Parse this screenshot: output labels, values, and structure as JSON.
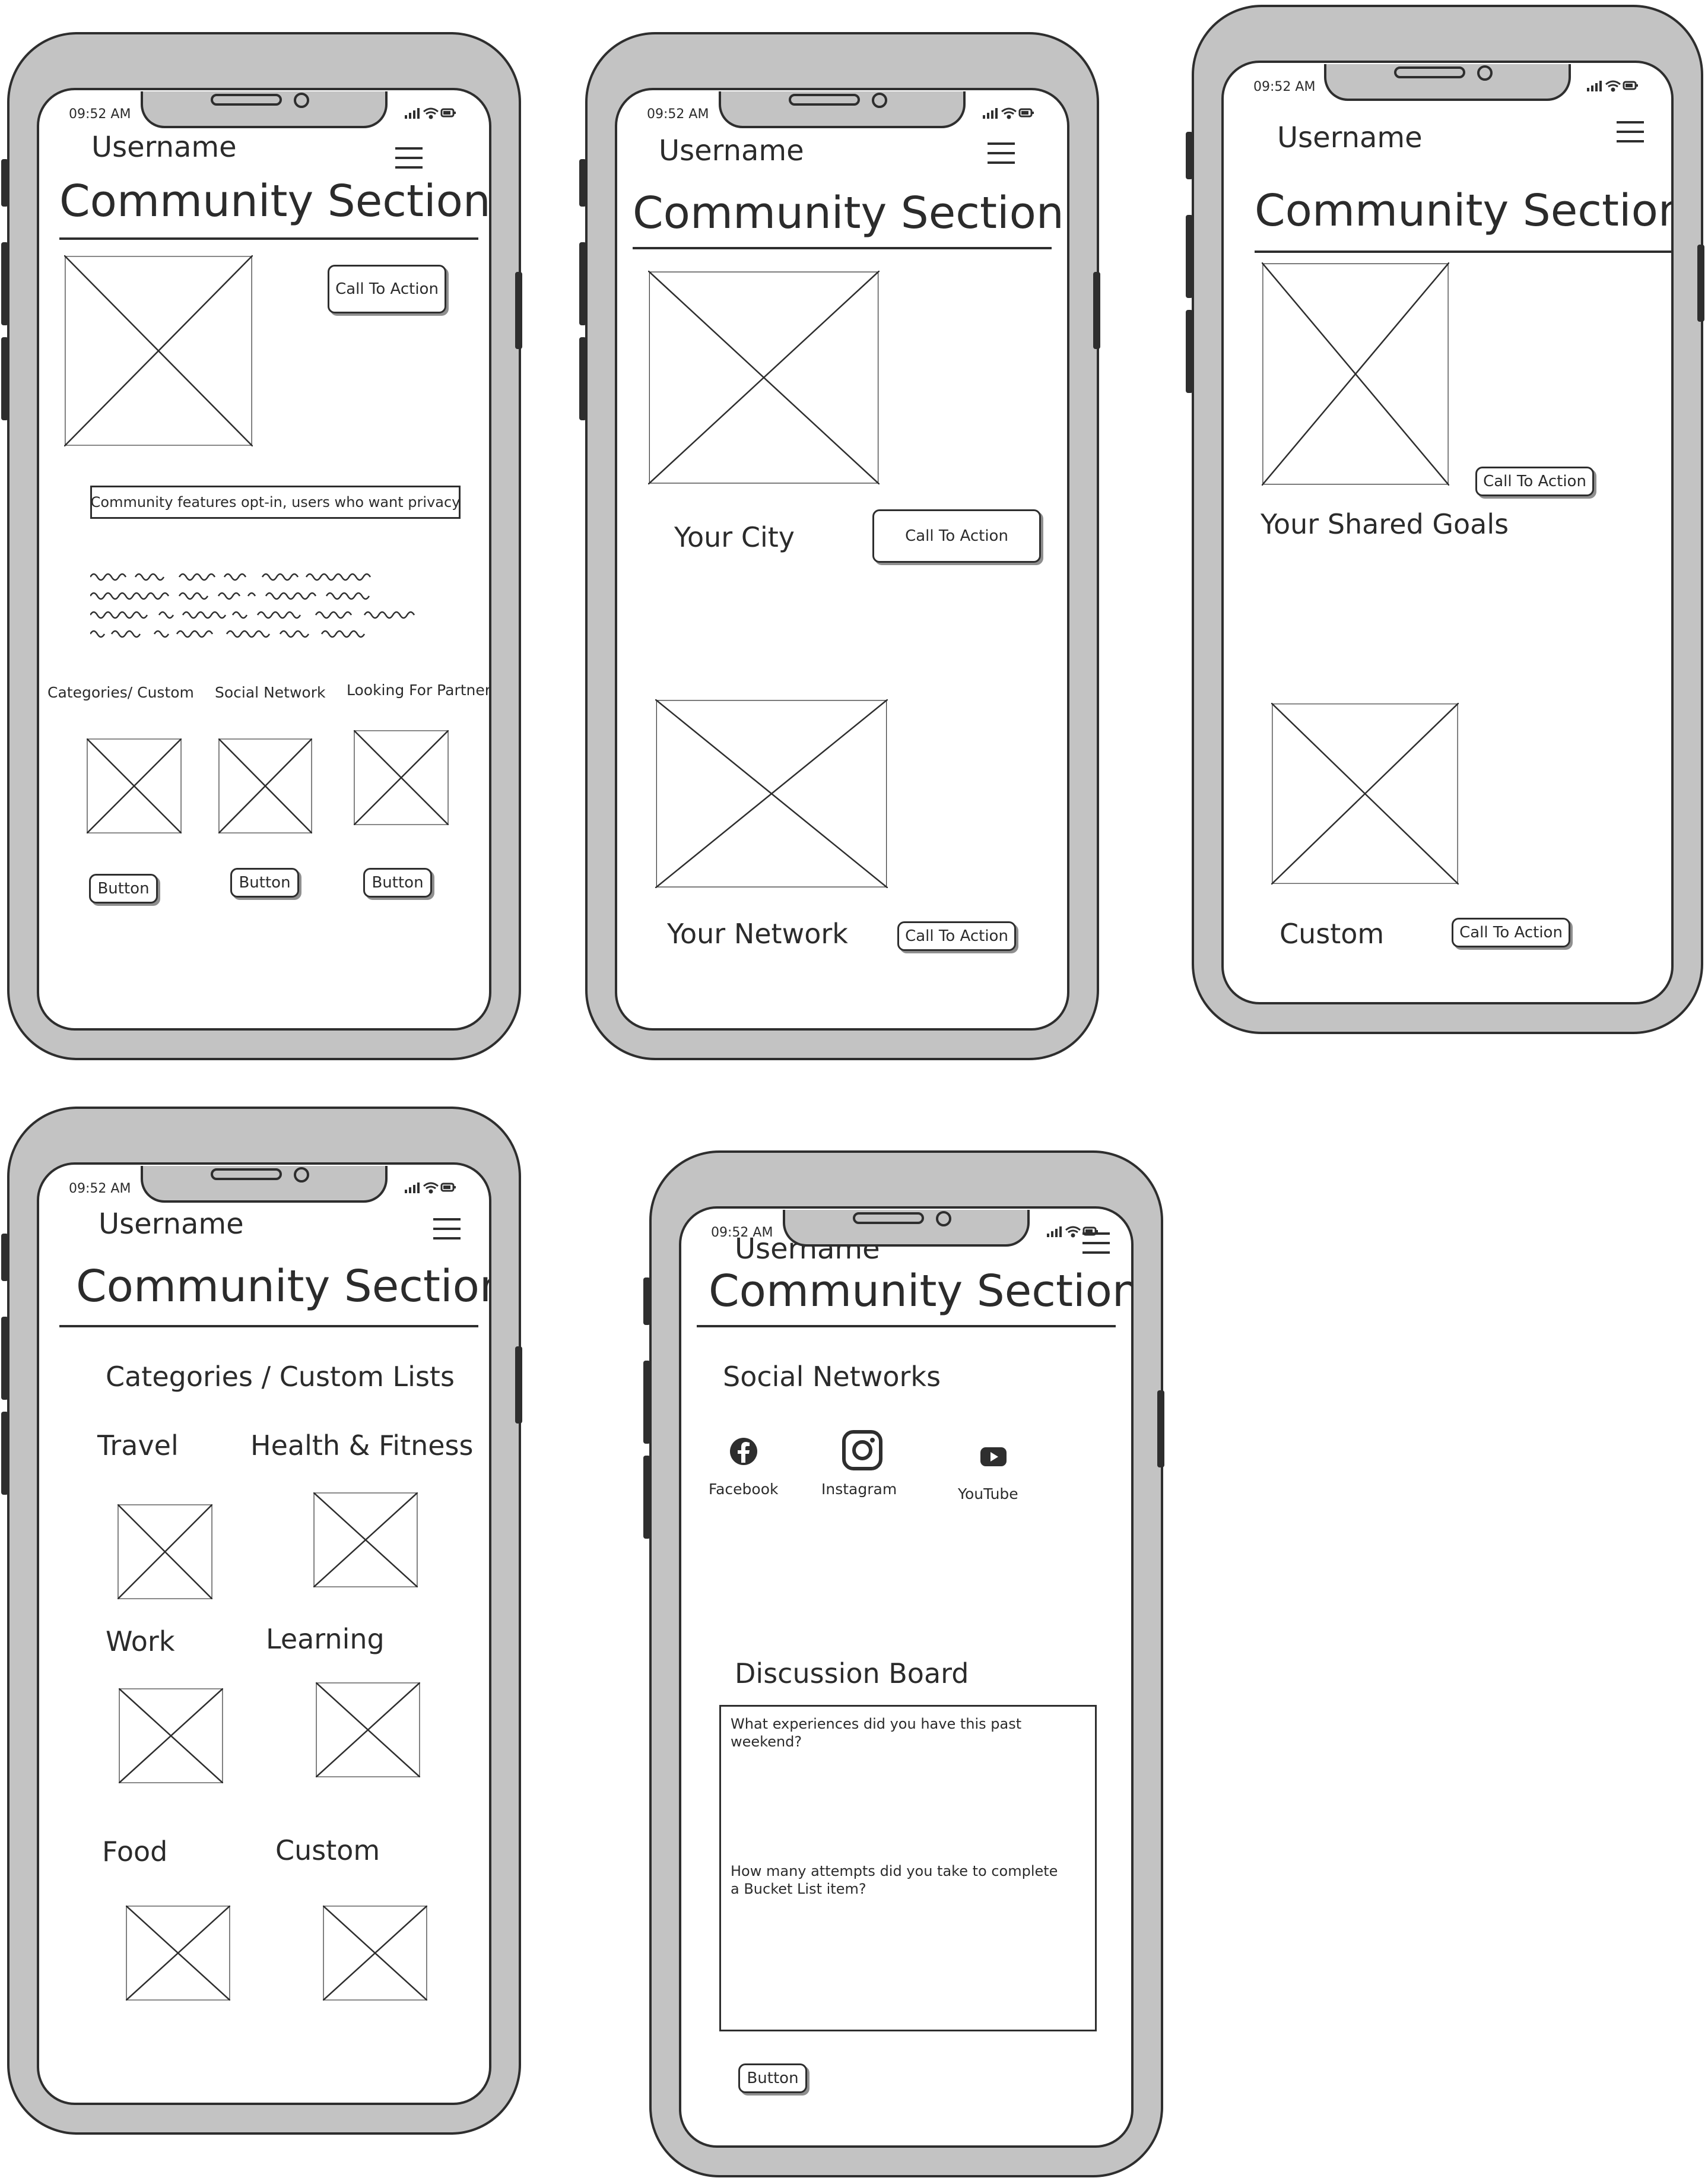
{
  "status_bar": {
    "time": "09:52 AM"
  },
  "header": {
    "username": "Username",
    "title": "Community Section"
  },
  "phone1": {
    "cta": "Call To Action",
    "notice": "Community features opt-in, users who want privacy",
    "categories": [
      {
        "label": "Categories/ Custom",
        "button": "Button"
      },
      {
        "label": "Social Network",
        "button": "Button"
      },
      {
        "label": "Looking For Partner",
        "button": "Button"
      }
    ]
  },
  "phone2": {
    "city_label": "Your City",
    "city_cta": "Call To Action",
    "network_label": "Your Network",
    "network_cta": "Call To Action"
  },
  "phone3": {
    "goals_cta": "Call To Action",
    "goals_label": "Your Shared Goals",
    "custom_label": "Custom",
    "custom_cta": "Call To Action"
  },
  "phone4": {
    "heading": "Categories / Custom Lists",
    "lists": [
      {
        "label": "Travel"
      },
      {
        "label": "Health & Fitness"
      },
      {
        "label": "Work"
      },
      {
        "label": "Learning"
      },
      {
        "label": "Food"
      },
      {
        "label": "Custom"
      }
    ]
  },
  "phone5": {
    "social_heading": "Social Networks",
    "socials": [
      {
        "label": "Facebook",
        "icon": "facebook-icon"
      },
      {
        "label": "Instagram",
        "icon": "instagram-icon"
      },
      {
        "label": "YouTube",
        "icon": "youtube-icon"
      }
    ],
    "board_heading": "Discussion Board",
    "questions": [
      "What experiences did you have this past weekend?",
      "How many attempts did you take to complete a Bucket List item?"
    ],
    "button": "Button"
  }
}
